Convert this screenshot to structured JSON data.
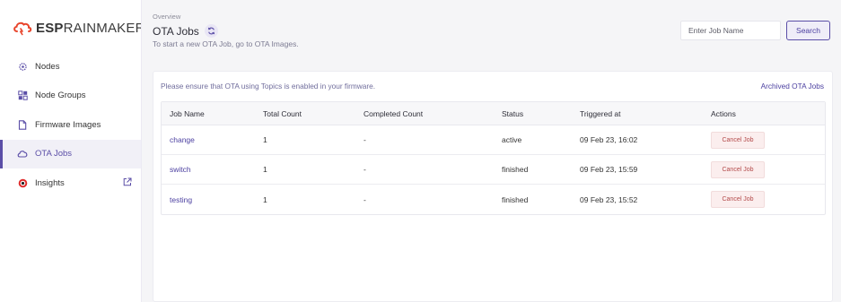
{
  "brand": {
    "bold": "ESP",
    "rest": "RAINMAKER",
    "accent_color": "#e8452c"
  },
  "sidebar": {
    "items": [
      {
        "label": "Nodes",
        "icon": "gear-chip-icon"
      },
      {
        "label": "Node Groups",
        "icon": "node-groups-icon"
      },
      {
        "label": "Firmware Images",
        "icon": "file-icon"
      },
      {
        "label": "OTA Jobs",
        "icon": "cloud-icon",
        "active": true
      },
      {
        "label": "Insights",
        "icon": "insights-icon",
        "external": true
      }
    ]
  },
  "header": {
    "breadcrumb": "Overview",
    "title": "OTA Jobs",
    "subtitle": "To start a new OTA Job, go to OTA Images."
  },
  "search": {
    "placeholder": "Enter Job Name",
    "button_label": "Search"
  },
  "card": {
    "notice": "Please ensure that OTA using Topics is enabled in your firmware.",
    "archived_link": "Archived OTA Jobs"
  },
  "table": {
    "columns": [
      "Job Name",
      "Total Count",
      "Completed Count",
      "Status",
      "Triggered at",
      "Actions"
    ],
    "rows": [
      {
        "job_name": "change",
        "total": "1",
        "completed": "-",
        "status": "active",
        "triggered": "09 Feb 23, 16:02",
        "action": "Cancel Job"
      },
      {
        "job_name": "switch",
        "total": "1",
        "completed": "-",
        "status": "finished",
        "triggered": "09 Feb 23, 15:59",
        "action": "Cancel Job"
      },
      {
        "job_name": "testing",
        "total": "1",
        "completed": "-",
        "status": "finished",
        "triggered": "09 Feb 23, 15:52",
        "action": "Cancel Job"
      }
    ]
  },
  "colors": {
    "primary": "#5b4ea7",
    "danger": "#b34a4a"
  }
}
